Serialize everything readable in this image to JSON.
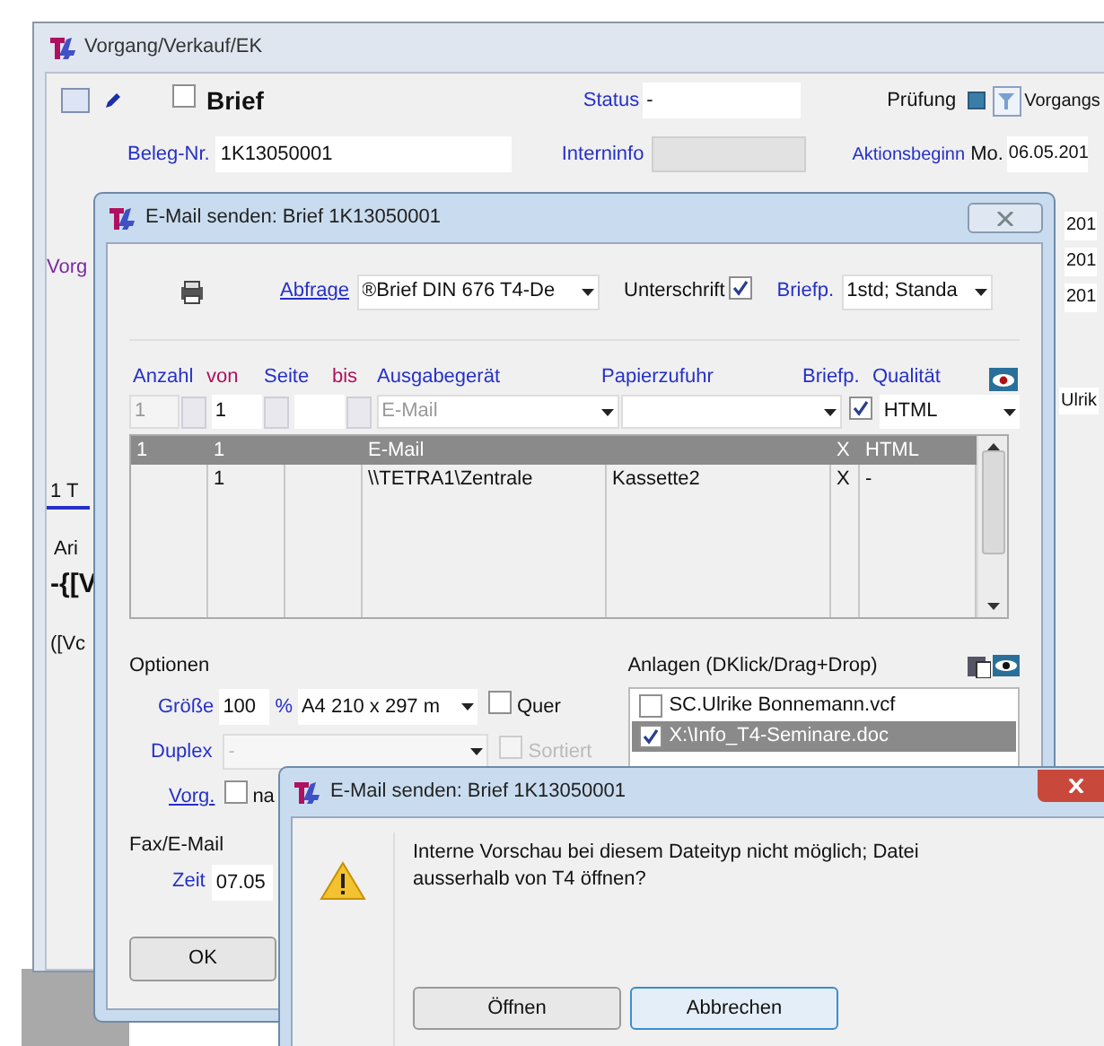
{
  "main_window": {
    "title": "Vorgang/Verkauf/EK",
    "toolbar": {
      "doc_checked": false,
      "doc_type": "Brief",
      "status_label": "Status",
      "status_value": "-",
      "check_label": "Prüfung",
      "filter_text": "Vorgangs"
    },
    "beleg_label": "Beleg-Nr.",
    "beleg_value": "1K13050001",
    "intern_label": "Interninfo",
    "aktion_label": "Aktionsbeginn",
    "aktion_day": "Mo.",
    "aktion_value": "06.05.201",
    "right_fragments": [
      "201",
      "201",
      "201"
    ],
    "right_name": "Ulrik",
    "left_fragments": [
      {
        "kind": "label",
        "text": "Vorg"
      },
      {
        "kind": "tab",
        "text": "1 T"
      },
      {
        "kind": "font",
        "text": "Ari"
      },
      {
        "kind": "bold",
        "text": "-{[V"
      },
      {
        "kind": "plain",
        "text": "([Vc"
      }
    ]
  },
  "send_dialog": {
    "title": "E-Mail senden: Brief 1K13050001",
    "abfrage_label": "Abfrage",
    "abfrage_value": "®Brief DIN 676 T4-De",
    "signature_label": "Unterschrift",
    "signature_checked": true,
    "letterhead_label": "Briefp.",
    "letterhead_value": "1std; Standa",
    "field_labels": [
      "Anzahl",
      "von",
      "Seite",
      "bis",
      "Ausgabegerät",
      "Papierzufuhr",
      "Briefp.",
      "Qualität"
    ],
    "input_row": {
      "anzahl": "1",
      "von": "1",
      "device": "E-Mail",
      "letterhead_checked": true,
      "quality": "HTML"
    },
    "entries": [
      {
        "selected": true,
        "cells": [
          "1",
          "1",
          "",
          "E-Mail",
          "",
          "X",
          "HTML"
        ]
      },
      {
        "selected": false,
        "cells": [
          "",
          "1",
          "",
          "\\\\TETRA1\\Zentrale",
          "Kassette2",
          "X",
          "-"
        ]
      }
    ],
    "options_title": "Optionen",
    "size_label": "Größe",
    "size_value": "100",
    "percent": "%",
    "paper_value": "A4 210 x 297 m",
    "landscape_label": "Quer",
    "landscape_checked": false,
    "duplex_label": "Duplex",
    "duplex_value": "-",
    "sorted_label": "Sortiert",
    "sorted_checked": false,
    "sorted_disabled": true,
    "vorg_label": "Vorg.",
    "vorg_checked": false,
    "vorg_text": "na",
    "fax_title": "Fax/E-Mail",
    "time_label": "Zeit",
    "time_value": "07.05",
    "ok_button": "OK",
    "attachments_title": "Anlagen (DKlick/Drag+Drop)",
    "attachments": [
      {
        "name": "SC.Ulrike Bonnemann.vcf",
        "checked": false,
        "selected": false
      },
      {
        "name": "X:\\Info_T4-Seminare.doc",
        "checked": true,
        "selected": true
      }
    ]
  },
  "alert": {
    "title": "E-Mail senden: Brief 1K13050001",
    "message": "Interne Vorschau bei diesem Dateityp nicht möglich; Datei ausserhalb von T4 öffnen?",
    "buttons": [
      {
        "label": "Öffnen",
        "selected": false
      },
      {
        "label": "Abbrechen",
        "selected": true
      }
    ]
  }
}
